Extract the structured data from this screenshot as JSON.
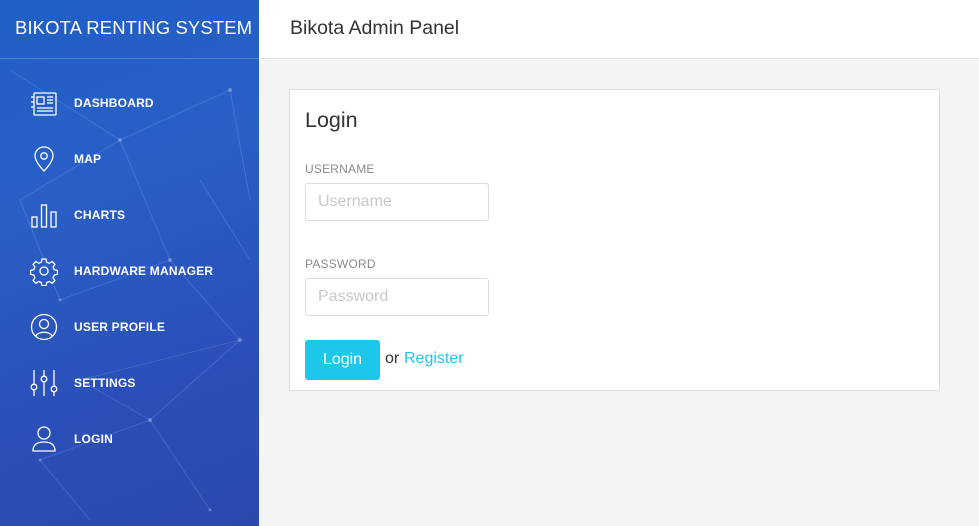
{
  "sidebar": {
    "brand": "BIKOTA RENTING SYSTEM",
    "items": [
      {
        "label": "DASHBOARD",
        "icon": "dashboard-icon"
      },
      {
        "label": "MAP",
        "icon": "map-pin-icon"
      },
      {
        "label": "CHARTS",
        "icon": "bar-chart-icon"
      },
      {
        "label": "HARDWARE MANAGER",
        "icon": "gear-icon"
      },
      {
        "label": "USER PROFILE",
        "icon": "user-circle-icon"
      },
      {
        "label": "SETTINGS",
        "icon": "sliders-icon"
      },
      {
        "label": "LOGIN",
        "icon": "user-icon"
      }
    ]
  },
  "header": {
    "title": "Bikota Admin Panel"
  },
  "login": {
    "title": "Login",
    "username_label": "USERNAME",
    "username_placeholder": "Username",
    "username_value": "",
    "password_label": "PASSWORD",
    "password_placeholder": "Password",
    "password_value": "",
    "login_button": "Login",
    "or_text": "or",
    "register_link": "Register"
  },
  "colors": {
    "accent": "#1dc7ea",
    "sidebar_top": "#1f5fc4",
    "sidebar_bottom": "#2a49b0"
  }
}
